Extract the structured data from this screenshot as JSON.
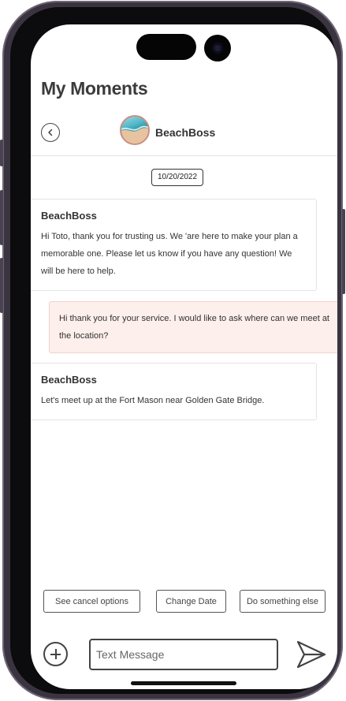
{
  "header": {
    "title": "My Moments",
    "contact_name": "BeachBoss"
  },
  "conversation": {
    "date": "10/20/2022",
    "messages": [
      {
        "direction": "incoming",
        "sender": "BeachBoss",
        "text": "Hi Toto, thank you for trusting us. We 'are here to make your plan a memorable one. Please let us know if you have any question! We will be here to help."
      },
      {
        "direction": "outgoing",
        "sender": "",
        "text": "Hi thank you for your service. I would like to ask where can we meet at the location?"
      },
      {
        "direction": "incoming",
        "sender": "BeachBoss",
        "text": "Let's meet up at the Fort Mason near Golden Gate Bridge."
      }
    ]
  },
  "quick_actions": [
    {
      "label": "See cancel options"
    },
    {
      "label": "Change Date"
    },
    {
      "label": "Do something else"
    }
  ],
  "composer": {
    "placeholder": "Text Message",
    "value": ""
  },
  "icons": {
    "back": "chevron-left-icon",
    "add": "plus-circle-icon",
    "send": "send-icon"
  },
  "colors": {
    "outgoing_bubble": "#fcefec",
    "outgoing_border": "#eed3cd",
    "title_text": "#3b3b3b"
  }
}
